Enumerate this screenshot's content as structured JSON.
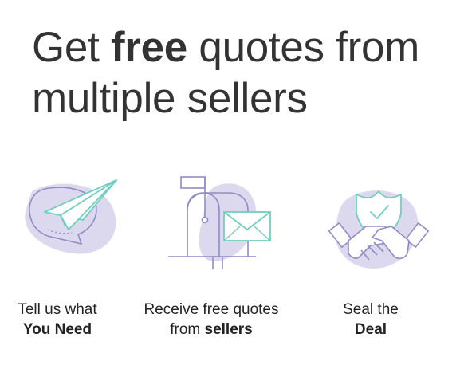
{
  "headline": {
    "part1": "Get ",
    "emphasis": "free",
    "part2": " quotes from multiple sellers"
  },
  "steps": [
    {
      "icon": "paper-plane-icon",
      "line1": "Tell us what",
      "line2": "You Need"
    },
    {
      "icon": "mailbox-icon",
      "line1": "Receive free quotes",
      "line2_prefix": "from ",
      "line2_bold": "sellers"
    },
    {
      "icon": "handshake-icon",
      "line1": "Seal the",
      "line2": "Deal"
    }
  ],
  "colors": {
    "blob": "#dcd9ee",
    "outline": "#8f8cc4",
    "accent": "#6fcfbe",
    "text": "#333333"
  }
}
